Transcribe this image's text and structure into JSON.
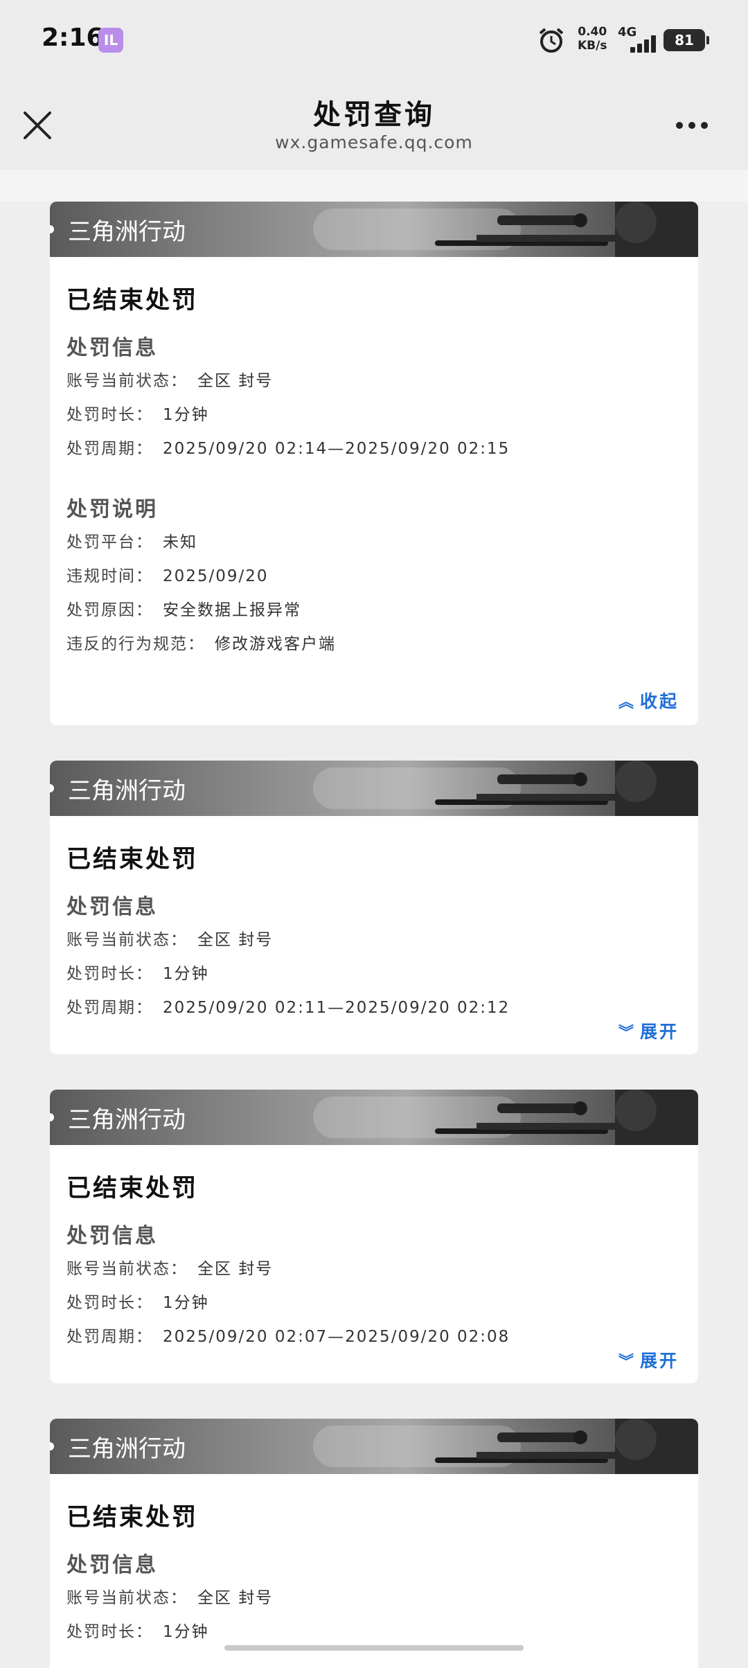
{
  "status_bar": {
    "time": "2:16",
    "app_badge": "IL",
    "net_speed_value": "0.40",
    "net_speed_unit": "KB/s",
    "network": "4G",
    "battery": "81"
  },
  "header": {
    "title": "处罚查询",
    "subtitle": "wx.gamesafe.qq.com"
  },
  "cards": [
    {
      "game": "三角洲行动",
      "status": "已结束处罚",
      "info_title": "处罚信息",
      "account_state_label": "账号当前状态：",
      "account_state_value": "全区 封号",
      "duration_label": "处罚时长：",
      "duration_value": "1分钟",
      "period_label": "处罚周期：",
      "period_value": "2025/09/20 02:14—2025/09/20 02:15",
      "desc_title": "处罚说明",
      "platform_label": "处罚平台：",
      "platform_value": "未知",
      "violation_time_label": "违规时间：",
      "violation_time_value": "2025/09/20",
      "reason_label": "处罚原因：",
      "reason_value": "安全数据上报异常",
      "rule_label": "违反的行为规范：",
      "rule_value": "修改游戏客户端",
      "toggle": "收起",
      "expanded": true
    },
    {
      "game": "三角洲行动",
      "status": "已结束处罚",
      "info_title": "处罚信息",
      "account_state_label": "账号当前状态：",
      "account_state_value": "全区 封号",
      "duration_label": "处罚时长：",
      "duration_value": "1分钟",
      "period_label": "处罚周期：",
      "period_value": "2025/09/20 02:11—2025/09/20 02:12",
      "toggle": "展开",
      "expanded": false
    },
    {
      "game": "三角洲行动",
      "status": "已结束处罚",
      "info_title": "处罚信息",
      "account_state_label": "账号当前状态：",
      "account_state_value": "全区 封号",
      "duration_label": "处罚时长：",
      "duration_value": "1分钟",
      "period_label": "处罚周期：",
      "period_value": "2025/09/20 02:07—2025/09/20 02:08",
      "toggle": "展开",
      "expanded": false
    },
    {
      "game": "三角洲行动",
      "status": "已结束处罚",
      "info_title": "处罚信息",
      "account_state_label": "账号当前状态：",
      "account_state_value": "全区 封号",
      "duration_label": "处罚时长：",
      "duration_value": "1分钟"
    }
  ],
  "icons": {
    "close": "close-icon",
    "more": "more-icon",
    "collapse": "chevron-double-up-icon",
    "expand": "chevron-double-down-icon"
  }
}
